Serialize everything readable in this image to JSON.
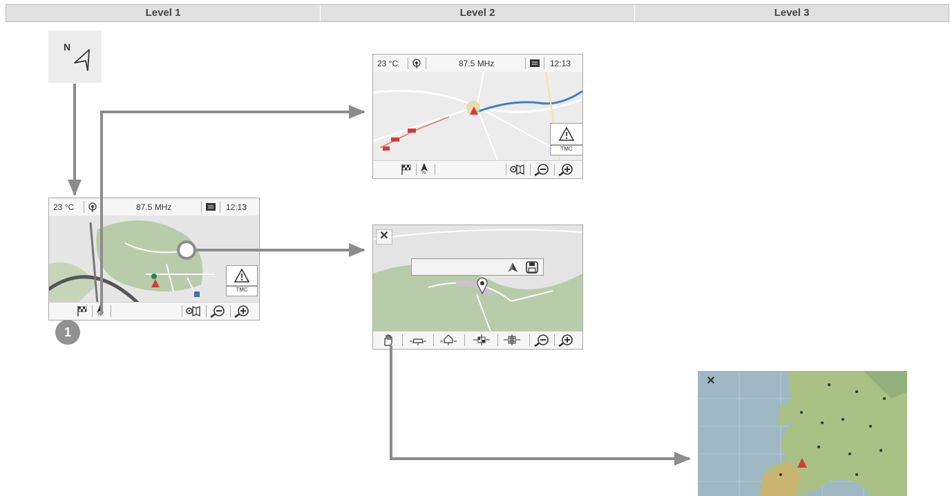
{
  "header": {
    "levels": [
      "Level 1",
      "Level 2",
      "Level 3"
    ]
  },
  "compass": {
    "label": "N",
    "icon": "compass-arrow-icon"
  },
  "status": {
    "temperature": "23 °C",
    "frequency": "87.5 MHz",
    "time": "12:13"
  },
  "traffic": {
    "label": "TMC",
    "warning_icon": "warning-triangle-icon"
  },
  "toolbar_main": {
    "icons": [
      "destination-flag-icon",
      "north-arrow-icon",
      "map-settings-icon",
      "zoom-out-icon",
      "zoom-in-icon"
    ],
    "north_label": "N"
  },
  "toolbar_cursor": {
    "icons": [
      "hand-pan-icon",
      "car-poi-icon",
      "home-poi-icon",
      "road-map-icon",
      "grid-map-icon",
      "zoom-out-icon",
      "zoom-in-icon"
    ]
  },
  "cursor_panel": {
    "icons": [
      "navigate-arrow-icon",
      "save-icon"
    ],
    "close_icon": "close-icon"
  },
  "callout": {
    "number": "1"
  },
  "colors": {
    "arrow": "#8c8c8c",
    "header_bg": "#e1e1e1",
    "map_green": "#b9ccaa",
    "route_blue": "#3f7fc4"
  }
}
